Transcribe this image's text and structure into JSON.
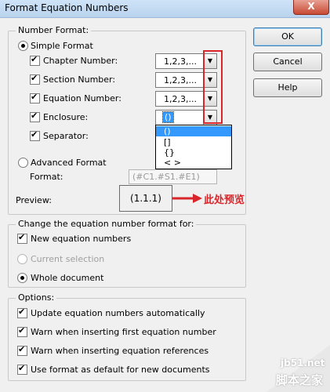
{
  "window": {
    "title": "Format Equation Numbers",
    "close": "X"
  },
  "number_format": {
    "group_label": "Number Format:",
    "simple_label": "Simple Format",
    "rows": [
      {
        "label": "Chapter Number:",
        "value": "1,2,3,..."
      },
      {
        "label": "Section Number:",
        "value": "1,2,3,..."
      },
      {
        "label": "Equation Number:",
        "value": "1,2,3,..."
      },
      {
        "label": "Enclosure:",
        "value": "()"
      },
      {
        "label": "Separator:"
      }
    ],
    "enclosure_options": [
      "()",
      "[]",
      "{}",
      "< >"
    ],
    "advanced_label": "Advanced Format",
    "format_label": "Format:",
    "format_value": "(#C1.#S1.#E1)",
    "preview_label": "Preview:",
    "preview_value": "(1.1.1)",
    "annotation": "此处预览"
  },
  "change_group": {
    "label": "Change the equation number format for:",
    "new_numbers": "New equation numbers",
    "current_selection": "Current selection",
    "whole_document": "Whole document"
  },
  "options": {
    "label": "Options:",
    "items": [
      "Update equation numbers automatically",
      "Warn when inserting first equation number",
      "Warn when inserting equation references",
      "Use format as default for new documents"
    ]
  },
  "buttons": {
    "ok": "OK",
    "cancel": "Cancel",
    "help": "Help"
  },
  "watermark": {
    "site": "jb51.net",
    "name": "脚本之家"
  }
}
